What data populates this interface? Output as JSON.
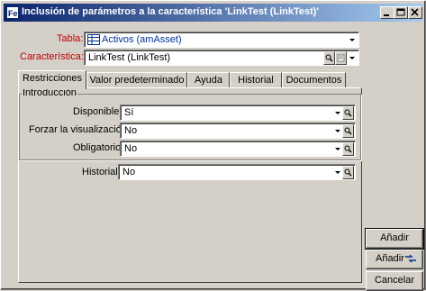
{
  "window": {
    "title": "Inclusión de parámetros a la característica 'LinkTest (LinkTest)'"
  },
  "form": {
    "tabla_label": "Tabla:",
    "tabla_value": "Activos (amAsset)",
    "caracteristica_label": "Característica:",
    "caracteristica_value": "LinkTest (LinkTest)"
  },
  "tabs": [
    {
      "label": "Restricciones"
    },
    {
      "label": "Valor predeterminado"
    },
    {
      "label": "Ayuda"
    },
    {
      "label": "Historial"
    },
    {
      "label": "Documentos"
    }
  ],
  "group": {
    "title": "Introducción",
    "fields": [
      {
        "label": "Disponible:",
        "value": "Sí"
      },
      {
        "label": "Forzar la visualización:",
        "value": "No"
      },
      {
        "label": "Obligatorio:",
        "value": "No"
      }
    ]
  },
  "historial": {
    "label": "Historial:",
    "value": "No"
  },
  "buttons": {
    "add1": "Añadir",
    "add2": "Añadir",
    "cancel": "Cancelar"
  },
  "colors": {
    "title_start": "#0a246a",
    "title_end": "#a6caf0",
    "label_red": "#c00000"
  }
}
